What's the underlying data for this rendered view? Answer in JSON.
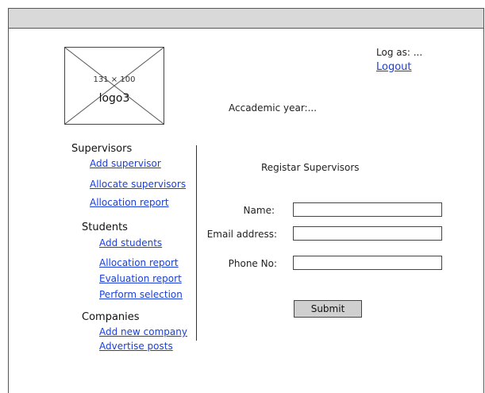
{
  "header": {
    "logo_dimensions": "131 × 100",
    "logo_label": "logo3",
    "logged_as": "Log as: ...",
    "logout_label": "Logout",
    "academic_year": "Accademic year:..."
  },
  "sidebar": {
    "supervisors": {
      "title": "Supervisors",
      "links": [
        "Add supervisor",
        "Allocate supervisors",
        "Allocation report"
      ]
    },
    "students": {
      "title": "Students",
      "links": [
        "Add students",
        "Allocation report",
        "Evaluation report",
        "Perform selection"
      ]
    },
    "companies": {
      "title": "Companies",
      "links": [
        "Add new company",
        "Advertise posts"
      ]
    }
  },
  "form": {
    "title": "Registar Supervisors",
    "name_label": "Name:",
    "email_label": "Email address:",
    "phone_label": "Phone No:",
    "name_value": "",
    "email_value": "",
    "phone_value": "",
    "submit_label": "Submit"
  }
}
